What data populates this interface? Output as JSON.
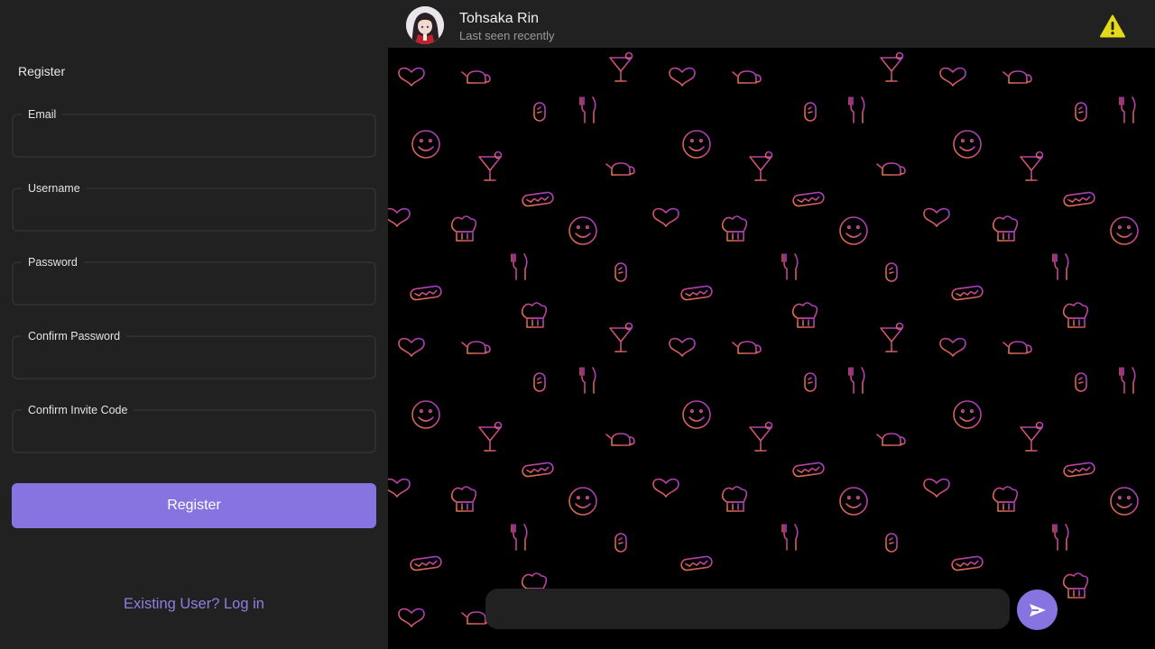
{
  "register": {
    "title": "Register",
    "fields": [
      {
        "label": "Email",
        "value": "",
        "placeholder": ""
      },
      {
        "label": "Username",
        "value": "",
        "placeholder": ""
      },
      {
        "label": "Password",
        "value": "",
        "placeholder": ""
      },
      {
        "label": "Confirm Password",
        "value": "",
        "placeholder": ""
      },
      {
        "label": "Confirm Invite Code",
        "value": "",
        "placeholder": ""
      }
    ],
    "submit_label": "Register",
    "login_link": "Existing User? Log in"
  },
  "chat": {
    "contact_name": "Tohsaka Rin",
    "contact_status": "Last seen recently",
    "warning_icon": "warning-icon",
    "composer_value": "",
    "send_icon": "send-arrow-icon",
    "background_pattern": "doodle-food-pattern"
  },
  "colors": {
    "panel": "#212121",
    "accent": "#8774e1",
    "link": "#8e7fe3",
    "warning": "#e3db1a",
    "pattern_gradient": [
      "#e07a3c",
      "#c94a7a",
      "#9a3ad6"
    ]
  }
}
